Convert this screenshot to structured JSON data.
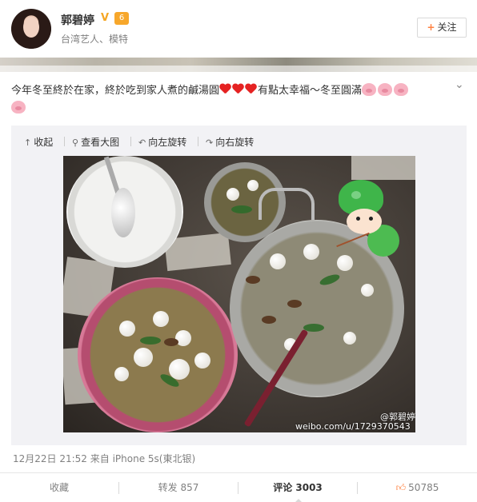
{
  "header": {
    "username": "郭碧婷",
    "verified_badge": "V",
    "vip_badge": "6",
    "description": "台湾艺人、模特",
    "follow_label": "关注"
  },
  "post": {
    "text_part1": "今年冬至終於在家，終於吃到家人煮的鹹湯圓",
    "text_part2": "有點太幸福～冬至圓滿",
    "emoji_hearts": 3,
    "emoji_pigs": 4
  },
  "media_toolbar": {
    "collapse": "收起",
    "view_large": "查看大图",
    "rotate_left": "向左旋转",
    "rotate_right": "向右旋转"
  },
  "photo": {
    "watermark_user": "@郭碧婷",
    "watermark_url": "weibo.com/u/1729370543"
  },
  "meta": {
    "timestamp_source": "12月22日 21:52 来自 iPhone 5s(東北银)"
  },
  "actions": {
    "favorite": "收藏",
    "repost": "转发 857",
    "comment": "评论 3003",
    "like": "50785"
  },
  "colors": {
    "accent_orange": "#ff8140",
    "heart_red": "#e52222",
    "pig_pink": "#f7b3c2",
    "media_bg": "#f2f2f5"
  }
}
